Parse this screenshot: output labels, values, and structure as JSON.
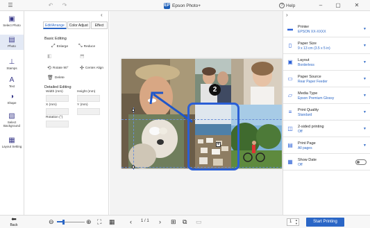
{
  "titlebar": {
    "app_title": "Epson Photo+",
    "app_logo": "EP",
    "help_label": "Help"
  },
  "rail": [
    {
      "name": "select-photo",
      "label": "Select Photo",
      "icon": "photo-frame-icon",
      "glyph": "▣",
      "active": false
    },
    {
      "name": "photo",
      "label": "Photo",
      "icon": "photo-icon",
      "glyph": "▤",
      "active": true
    },
    {
      "name": "stamps",
      "label": "Stamps",
      "icon": "stamp-icon",
      "glyph": "⊥",
      "active": false
    },
    {
      "name": "text",
      "label": "Text",
      "icon": "text-icon",
      "glyph": "A",
      "active": false
    },
    {
      "name": "shape",
      "label": "Shape",
      "icon": "shape-icon",
      "glyph": "◑",
      "active": false
    },
    {
      "name": "select-background",
      "label": "Select Background",
      "icon": "background-icon",
      "glyph": "▧",
      "active": false
    },
    {
      "name": "layout-setting",
      "label": "Layout Setting",
      "icon": "layout-icon",
      "glyph": "▦",
      "active": false
    }
  ],
  "edit_panel": {
    "tabs": [
      "Edit/Arrange",
      "Color Adjust",
      "Effect"
    ],
    "active_tab": 0,
    "basic_editing": "Basic Editing",
    "tools": {
      "enlarge": "Enlarge",
      "reduce": "Reduce",
      "rotate": "Rotate 90°",
      "center_align": "Center Align",
      "delete": "Delete"
    },
    "detailed_editing": "Detailed Editing",
    "fields": {
      "width": "Width (mm)",
      "height": "Height (mm)",
      "x": "X (mm)",
      "y": "Y (mm)",
      "rotation": "Rotation (°)"
    }
  },
  "canvas": {
    "callout_number": "2"
  },
  "print_settings": [
    {
      "name": "printer",
      "title": "Printer",
      "value": "EPSON XX-XXXX",
      "icon": "printer-icon",
      "glyph": "▬",
      "control": "dropdown"
    },
    {
      "name": "paper-size",
      "title": "Paper Size",
      "value": "9 x 13 cm (3.5 x 5 in)",
      "icon": "paper-size-icon",
      "glyph": "▯",
      "control": "dropdown"
    },
    {
      "name": "layout",
      "title": "Layout",
      "value": "Borderless",
      "icon": "layout-icon",
      "glyph": "▣",
      "control": "dropdown"
    },
    {
      "name": "paper-source",
      "title": "Paper Source",
      "value": "Rear Paper Feeder",
      "icon": "paper-source-icon",
      "glyph": "▭",
      "control": "dropdown"
    },
    {
      "name": "media-type",
      "title": "Media Type",
      "value": "Epson Premium Glossy",
      "icon": "media-type-icon",
      "glyph": "▱",
      "control": "dropdown"
    },
    {
      "name": "print-quality",
      "title": "Print Quality",
      "value": "Standard",
      "icon": "print-quality-icon",
      "glyph": "≡",
      "control": "dropdown"
    },
    {
      "name": "two-sided",
      "title": "2-sided printing",
      "value": "Off",
      "icon": "two-sided-icon",
      "glyph": "◫",
      "control": "dropdown"
    },
    {
      "name": "print-page",
      "title": "Print Page",
      "value": "All pages",
      "icon": "print-page-icon",
      "glyph": "▤",
      "control": "dropdown"
    },
    {
      "name": "show-date",
      "title": "Show Date",
      "value": "Off",
      "icon": "show-date-icon",
      "glyph": "▦",
      "control": "toggle"
    }
  ],
  "bottom": {
    "back_label": "Back",
    "page_indicator": "1 / 1",
    "copies": "1",
    "start_printing": "Start Printing"
  }
}
